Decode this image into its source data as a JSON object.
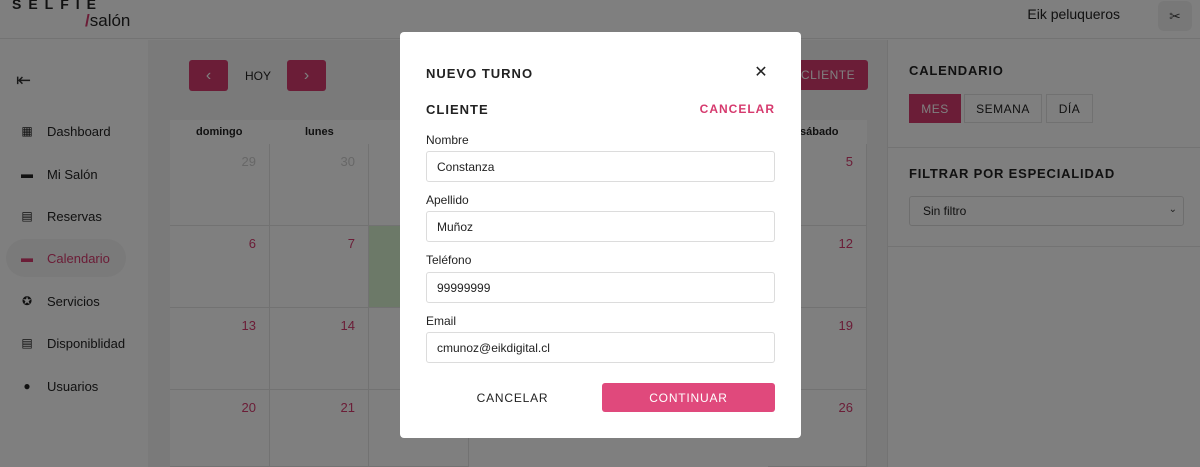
{
  "brand": {
    "line1": "SELFIE",
    "star": "*",
    "slash": "/",
    "line2": "salón"
  },
  "header": {
    "user_name": "Eik peluqueros",
    "avatar_icon": "scissors-icon"
  },
  "sidebar": {
    "items": [
      {
        "label": "Dashboard",
        "icon": "grid-icon"
      },
      {
        "label": "Mi Salón",
        "icon": "store-icon"
      },
      {
        "label": "Reservas",
        "icon": "clipboard-icon"
      },
      {
        "label": "Calendario",
        "icon": "calendar-icon"
      },
      {
        "label": "Servicios",
        "icon": "badge-check-icon"
      },
      {
        "label": "Disponiblidad",
        "icon": "clipboard-icon"
      },
      {
        "label": "Usuarios",
        "icon": "person-icon"
      }
    ],
    "active_index": 3
  },
  "toolbar": {
    "today_label": "HOY",
    "new_client_label": "CLIENTE"
  },
  "calendar": {
    "day_headers": [
      "domingo",
      "lunes",
      "",
      "",
      "",
      "",
      "sábado"
    ],
    "weeks": [
      [
        "29",
        "30",
        "",
        "",
        "",
        "",
        "5"
      ],
      [
        "6",
        "7",
        "",
        "",
        "",
        "",
        "12"
      ],
      [
        "13",
        "14",
        "",
        "",
        "",
        "",
        "19"
      ],
      [
        "20",
        "21",
        "",
        "",
        "",
        "",
        "26"
      ]
    ]
  },
  "right_panel": {
    "calendar_title": "CALENDARIO",
    "views": [
      "MES",
      "SEMANA",
      "DÍA"
    ],
    "active_view": "MES",
    "filter_title": "FILTRAR POR ESPECIALIDAD",
    "filter_value": "Sin filtro"
  },
  "modal": {
    "title": "NUEVO TURNO",
    "section": "CLIENTE",
    "cancel_link": "CANCELAR",
    "fields": {
      "nombre": {
        "label": "Nombre",
        "value": "Constanza"
      },
      "apellido": {
        "label": "Apellido",
        "value": "Muñoz"
      },
      "telefono": {
        "label": "Teléfono",
        "value": "99999999"
      },
      "email": {
        "label": "Email",
        "value": "cmunoz@eikdigital.cl"
      }
    },
    "cancel_button": "CANCELAR",
    "continue_button": "CONTINUAR"
  },
  "colors": {
    "accent": "#d63a6e",
    "today_bg": "#d9f2d0"
  }
}
